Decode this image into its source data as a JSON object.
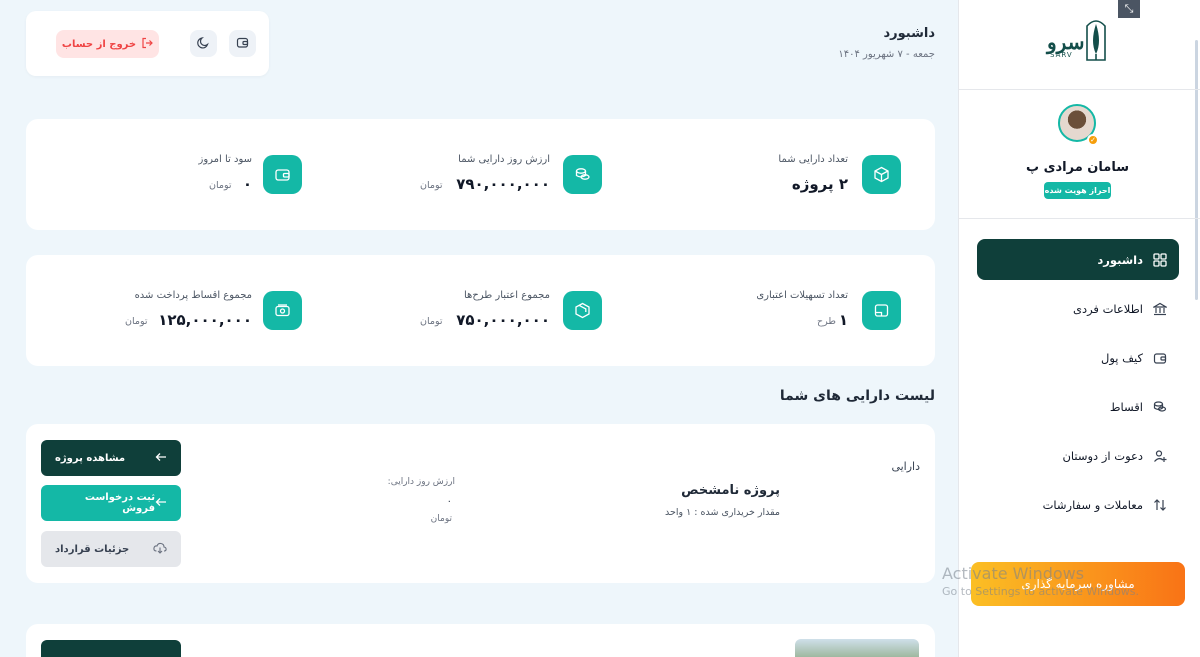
{
  "brand": {
    "wordmark": "سرو",
    "sub": "SARV"
  },
  "user": {
    "name": "سامان مرادی پ",
    "verified": "احراز هویت شده"
  },
  "nav": [
    {
      "label": "داشبورد",
      "icon": "grid-icon",
      "active": true
    },
    {
      "label": "اطلاعات فردی",
      "icon": "bank-icon",
      "active": false
    },
    {
      "label": "کیف پول",
      "icon": "wallet-icon",
      "active": false
    },
    {
      "label": "اقساط",
      "icon": "coins-icon",
      "active": false
    },
    {
      "label": "دعوت از دوستان",
      "icon": "user-plus-icon",
      "active": false
    },
    {
      "label": "معاملات و سفارشات",
      "icon": "arrows-updown-icon",
      "active": false
    }
  ],
  "consult": {
    "label": "مشاوره سرمایه گذاری"
  },
  "windows_watermark": {
    "line1": "Activate Windows",
    "line2": "Go to Settings to activate Windows."
  },
  "header": {
    "title": "داشبورد",
    "date": "جمعه - ۷ شهریور ۱۴۰۴",
    "logout": "خروج از حساب"
  },
  "stats_row1": [
    {
      "label": "تعداد دارایی شما",
      "value": "۲ پروژه",
      "unit": ""
    },
    {
      "label": "ارزش روز دارایی شما",
      "value": "۷۹۰,۰۰۰,۰۰۰",
      "unit": "تومان"
    },
    {
      "label": "سود تا امروز",
      "value": "۰",
      "unit": "تومان"
    }
  ],
  "stats_row2": [
    {
      "label": "تعداد تسهیلات اعتباری",
      "value": "۱",
      "unit": "طرح"
    },
    {
      "label": "مجموع اعتبار طرح‌ها",
      "value": "۷۵۰,۰۰۰,۰۰۰",
      "unit": "تومان"
    },
    {
      "label": "مجموع اقساط پرداخت شده",
      "value": "۱۲۵,۰۰۰,۰۰۰",
      "unit": "تومان"
    }
  ],
  "assets": {
    "title": "لیست دارایی های شما",
    "item": {
      "tag": "دارایی",
      "name": "پروژه نامشخص",
      "quantity": "مقدار خریداری شده : ۱ واحد",
      "value_label": "ارزش روز دارایی:",
      "value": "۰",
      "value_unit": "تومان",
      "view_project": "مشاهده پروژه",
      "sell_request": "ثبت درخواست فروش",
      "contract_details": "جزئیات قرارداد"
    }
  },
  "colors": {
    "primary_dark": "#0f3f3a",
    "teal": "#14b8a6",
    "danger": "#ef4444",
    "accent_orange": "#f97316"
  }
}
